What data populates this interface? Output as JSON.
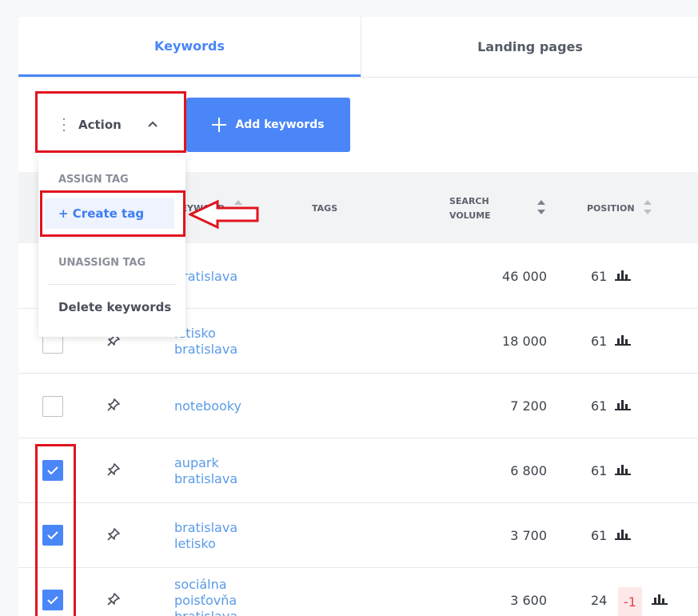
{
  "tabs": [
    {
      "label": "Keywords",
      "active": true
    },
    {
      "label": "Landing pages",
      "active": false
    }
  ],
  "toolbar": {
    "action_label": "Action",
    "add_label": "Add keywords"
  },
  "dropdown": {
    "assign_heading": "ASSIGN TAG",
    "create_tag": "+ Create tag",
    "unassign_heading": "UNASSIGN TAG",
    "delete_keywords": "Delete keywords"
  },
  "table": {
    "headers": {
      "keyword": "KEYWORD",
      "tags": "TAGS",
      "search_volume_line1": "SEARCH",
      "search_volume_line2": "VOLUME",
      "position": "POSITION"
    },
    "rows": [
      {
        "keyword_line1": "bratislava",
        "keyword_line2": "",
        "keyword_line3": "",
        "volume": "46 000",
        "position": "61",
        "delta": "",
        "checked": false
      },
      {
        "keyword_line1": "letisko",
        "keyword_line2": "bratislava",
        "keyword_line3": "",
        "volume": "18 000",
        "position": "61",
        "delta": "",
        "checked": false
      },
      {
        "keyword_line1": "notebooky",
        "keyword_line2": "",
        "keyword_line3": "",
        "volume": "7 200",
        "position": "61",
        "delta": "",
        "checked": false
      },
      {
        "keyword_line1": "aupark",
        "keyword_line2": "bratislava",
        "keyword_line3": "",
        "volume": "6 800",
        "position": "61",
        "delta": "",
        "checked": true
      },
      {
        "keyword_line1": "bratislava",
        "keyword_line2": "letisko",
        "keyword_line3": "",
        "volume": "3 700",
        "position": "61",
        "delta": "",
        "checked": true
      },
      {
        "keyword_line1": "sociálna",
        "keyword_line2": "poisťovňa",
        "keyword_line3": "bratislava",
        "volume": "3 600",
        "position": "24",
        "delta": "-1",
        "checked": true
      }
    ]
  },
  "colors": {
    "accent": "#4a86f7",
    "highlight": "#e0141e",
    "keyword_link": "#5a9be8"
  },
  "icons": {
    "kebab": "kebab-icon",
    "chevron": "chevron-up-icon",
    "plus": "plus-icon",
    "sort": "sort-icon",
    "pin": "pin-icon",
    "chart": "bar-chart-icon",
    "check": "check-icon",
    "arrow": "annotation-arrow-icon"
  }
}
